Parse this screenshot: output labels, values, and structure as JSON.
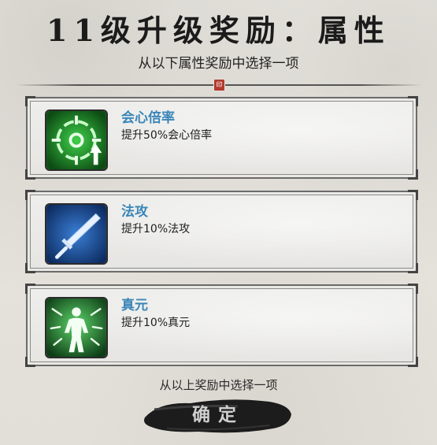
{
  "header": {
    "title": "11级升级奖励：属性",
    "subtitle": "从以下属性奖励中选择一项"
  },
  "options": [
    {
      "name": "会心倍率",
      "desc": "提升50%会心倍率",
      "icon": "crit-target-icon",
      "color": "#1f8c2a"
    },
    {
      "name": "法攻",
      "desc": "提升10%法攻",
      "icon": "sword-icon",
      "color": "#1c4f9e"
    },
    {
      "name": "真元",
      "desc": "提升10%真元",
      "icon": "energy-body-icon",
      "color": "#1a6a2c"
    }
  ],
  "footer": {
    "hint": "从以上奖励中选择一项",
    "confirm_label": "确定"
  }
}
